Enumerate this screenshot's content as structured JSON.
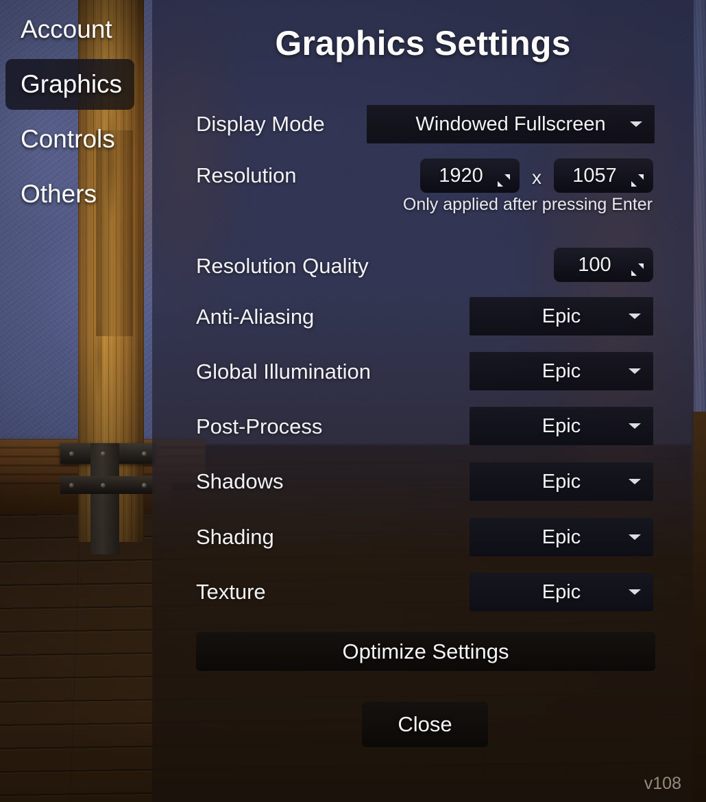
{
  "nav": {
    "items": [
      {
        "label": "Account",
        "active": false
      },
      {
        "label": "Graphics",
        "active": true
      },
      {
        "label": "Controls",
        "active": false
      },
      {
        "label": "Others",
        "active": false
      }
    ]
  },
  "panel": {
    "title": "Graphics Settings",
    "display_mode": {
      "label": "Display Mode",
      "value": "Windowed Fullscreen",
      "icon": "chevron-down-icon"
    },
    "resolution": {
      "label": "Resolution",
      "width_value": "1920",
      "separator": "x",
      "height_value": "1057",
      "hint": "Only applied after pressing Enter",
      "icon": "spinner-drag-icon"
    },
    "resolution_quality": {
      "label": "Resolution Quality",
      "value": "100",
      "icon": "spinner-drag-icon"
    },
    "quality_rows": [
      {
        "label": "Anti-Aliasing",
        "value": "Epic",
        "icon": "chevron-down-icon"
      },
      {
        "label": "Global Illumination",
        "value": "Epic",
        "icon": "chevron-down-icon"
      },
      {
        "label": "Post-Process",
        "value": "Epic",
        "icon": "chevron-down-icon"
      },
      {
        "label": "Shadows",
        "value": "Epic",
        "icon": "chevron-down-icon"
      },
      {
        "label": "Shading",
        "value": "Epic",
        "icon": "chevron-down-icon"
      },
      {
        "label": "Texture",
        "value": "Epic",
        "icon": "chevron-down-icon"
      }
    ],
    "optimize_button": "Optimize Settings",
    "close_button": "Close",
    "version": "v108"
  },
  "colors": {
    "panel_overlay": "#2a2c46",
    "control_dark": "#14141c",
    "text_primary": "#f2f2f5",
    "wall_blue": "#5a6393",
    "wood_pillar": "#a5752f",
    "warm_glow": "#dc7a1e",
    "floor_wood": "#3a2715"
  }
}
